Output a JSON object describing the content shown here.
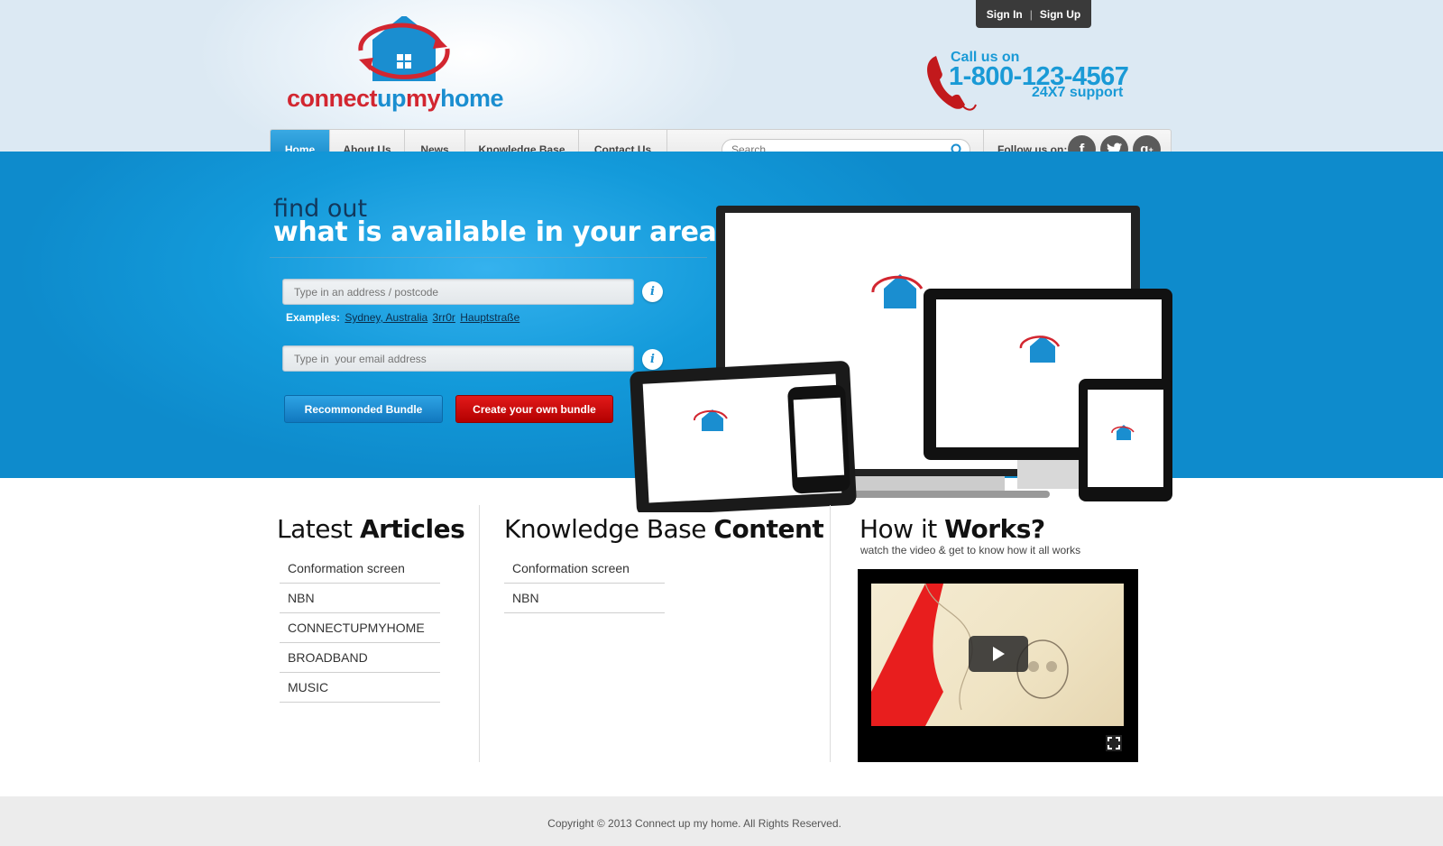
{
  "auth": {
    "sign_in": "Sign In",
    "separator": "|",
    "sign_up": "Sign Up"
  },
  "logo": {
    "part1": "connect",
    "part2": "up",
    "part3": "my",
    "part4": "home"
  },
  "contact": {
    "label": "Call us on",
    "number": "1-800-123-4567",
    "support": "24X7 support"
  },
  "nav": {
    "items": [
      "Home",
      "About Us",
      "News",
      "Knowledge Base",
      "Contact Us"
    ],
    "active": "Home",
    "search_placeholder": "Search...",
    "follow_label": "Follow us on:",
    "social": [
      "facebook-icon",
      "twitter-icon",
      "google-plus-icon"
    ]
  },
  "hero": {
    "title_line1": "find out",
    "title_line2": "what is available in your area...",
    "address_placeholder": "Type in an address / postcode",
    "examples_label": "Examples:",
    "examples": [
      "Sydney, Australia",
      "3rr0r",
      "Hauptstraße"
    ],
    "email_placeholder": "Type in  your email address",
    "btn_recommended": "Recommonded Bundle",
    "btn_create": "Create your own bundle"
  },
  "articles": {
    "title_light": "Latest ",
    "title_bold": "Articles",
    "items": [
      "Conformation screen",
      "NBN",
      "CONNECTUPMYHOME",
      "BROADBAND",
      "MUSIC"
    ]
  },
  "knowledge": {
    "title_light": "Knowledge Base ",
    "title_bold": "Content",
    "items": [
      "Conformation screen",
      "NBN"
    ]
  },
  "how": {
    "title_light": "How it ",
    "title_bold": "Works?",
    "subtitle": "watch the video & get to know how it all works"
  },
  "footer": {
    "copyright": "Copyright © 2013 Connect up my home. All Rights Reserved."
  },
  "colors": {
    "brand_blue": "#139ada",
    "brand_red": "#d22630",
    "nav_active": "#1a8ed0"
  }
}
